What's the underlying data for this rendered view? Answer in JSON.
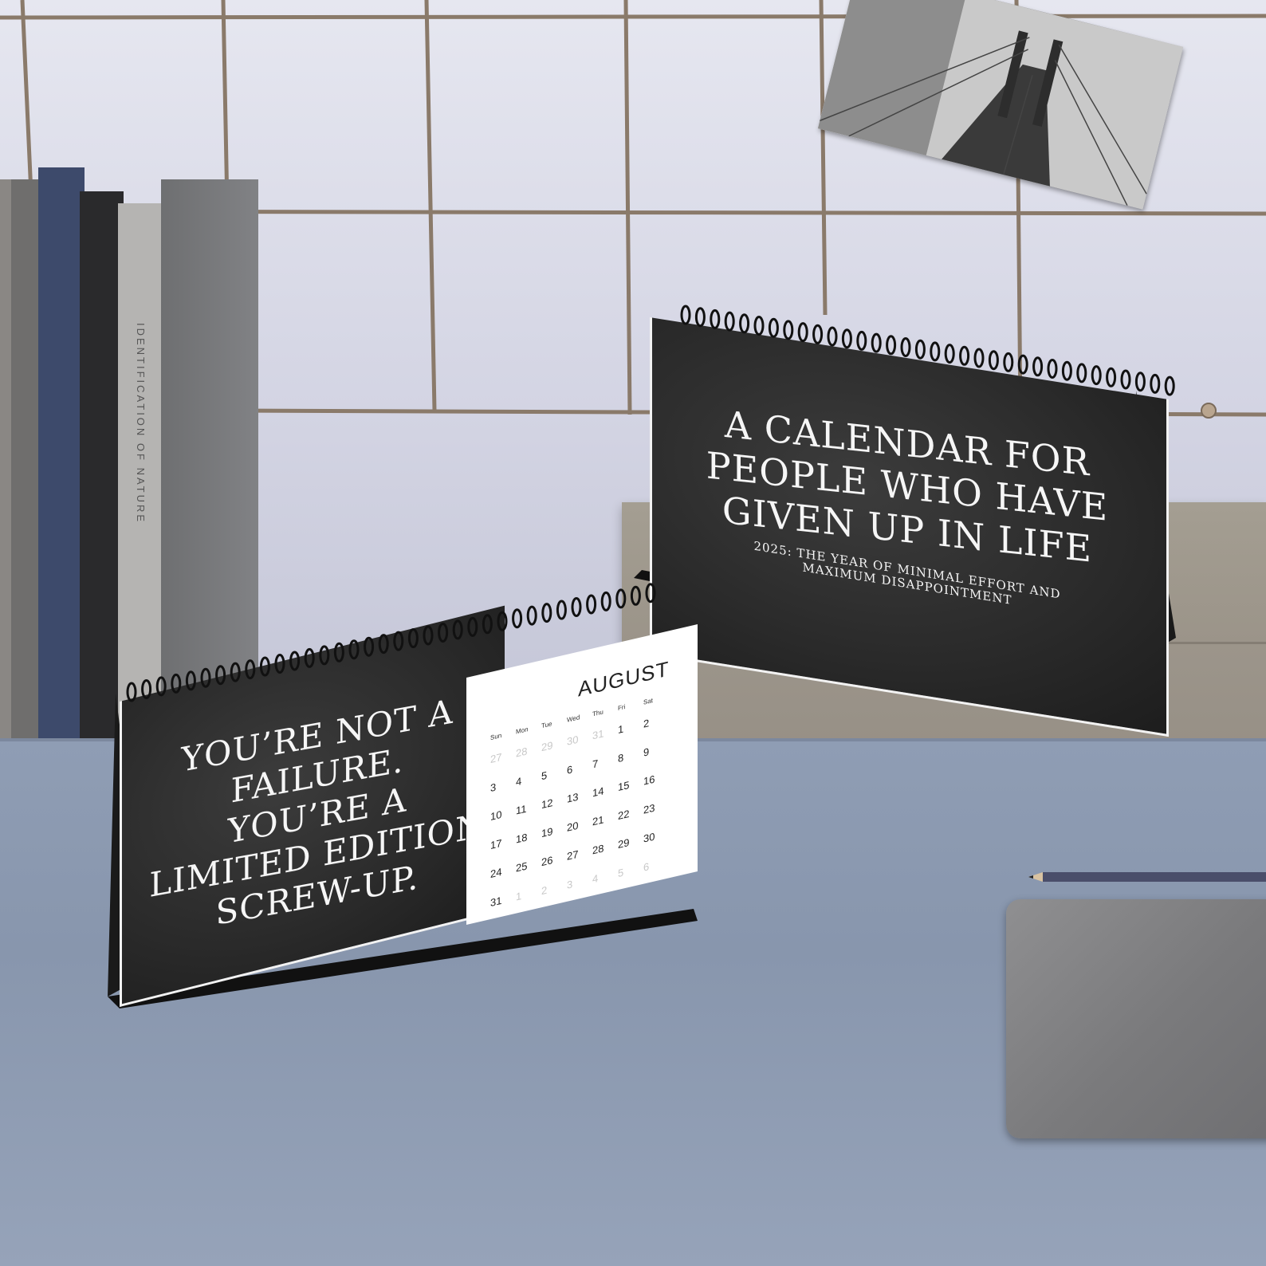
{
  "book_spine": {
    "title": "IDENTIFICATION OF NATURE"
  },
  "cover_calendar": {
    "title_lines": [
      "A CALENDAR FOR",
      "PEOPLE WHO HAVE",
      "GIVEN UP IN LIFE"
    ],
    "subtitle_lines": [
      "2025: THE YEAR OF MINIMAL EFFORT AND",
      "MAXIMUM DISAPPOINTMENT"
    ]
  },
  "open_calendar": {
    "quote_lines": [
      "YOU’RE NOT A",
      "FAILURE.",
      "YOU’RE A",
      "LIMITED EDITION",
      "SCREW-UP."
    ],
    "month": "AUGUST",
    "weekdays": [
      "Sun",
      "Mon",
      "Tue",
      "Wed",
      "Thu",
      "Fri",
      "Sat"
    ],
    "weeks": [
      [
        {
          "d": "27",
          "m": true
        },
        {
          "d": "28",
          "m": true
        },
        {
          "d": "29",
          "m": true
        },
        {
          "d": "30",
          "m": true
        },
        {
          "d": "31",
          "m": true
        },
        {
          "d": "1",
          "m": false
        },
        {
          "d": "2",
          "m": false
        }
      ],
      [
        {
          "d": "3",
          "m": false
        },
        {
          "d": "4",
          "m": false
        },
        {
          "d": "5",
          "m": false
        },
        {
          "d": "6",
          "m": false
        },
        {
          "d": "7",
          "m": false
        },
        {
          "d": "8",
          "m": false
        },
        {
          "d": "9",
          "m": false
        }
      ],
      [
        {
          "d": "10",
          "m": false
        },
        {
          "d": "11",
          "m": false
        },
        {
          "d": "12",
          "m": false
        },
        {
          "d": "13",
          "m": false
        },
        {
          "d": "14",
          "m": false
        },
        {
          "d": "15",
          "m": false
        },
        {
          "d": "16",
          "m": false
        }
      ],
      [
        {
          "d": "17",
          "m": false
        },
        {
          "d": "18",
          "m": false
        },
        {
          "d": "19",
          "m": false
        },
        {
          "d": "20",
          "m": false
        },
        {
          "d": "21",
          "m": false
        },
        {
          "d": "22",
          "m": false
        },
        {
          "d": "23",
          "m": false
        }
      ],
      [
        {
          "d": "24",
          "m": false
        },
        {
          "d": "25",
          "m": false
        },
        {
          "d": "26",
          "m": false
        },
        {
          "d": "27",
          "m": false
        },
        {
          "d": "28",
          "m": false
        },
        {
          "d": "29",
          "m": false
        },
        {
          "d": "30",
          "m": false
        }
      ],
      [
        {
          "d": "31",
          "m": false
        },
        {
          "d": "1",
          "m": true
        },
        {
          "d": "2",
          "m": true
        },
        {
          "d": "3",
          "m": true
        },
        {
          "d": "4",
          "m": true
        },
        {
          "d": "5",
          "m": true
        },
        {
          "d": "6",
          "m": true
        }
      ]
    ]
  }
}
